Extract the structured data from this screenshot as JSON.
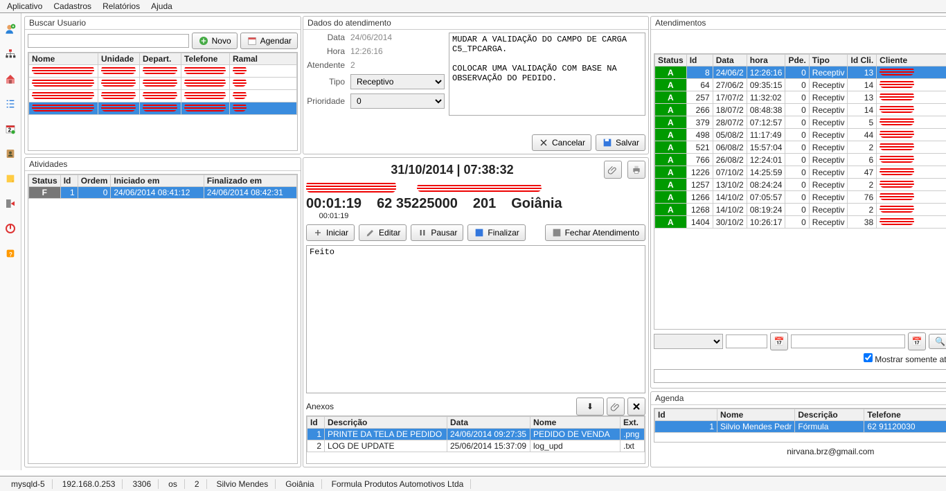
{
  "menu": {
    "app": "Aplicativo",
    "cad": "Cadastros",
    "rel": "Relatórios",
    "ajuda": "Ajuda"
  },
  "search": {
    "title": "Buscar Usuario",
    "novo": "Novo",
    "agendar": "Agendar",
    "cols": {
      "nome": "Nome",
      "unidade": "Unidade",
      "depart": "Depart.",
      "tel": "Telefone",
      "ramal": "Ramal"
    }
  },
  "atividades": {
    "title": "Atividades",
    "cols": {
      "status": "Status",
      "id": "Id",
      "ordem": "Ordem",
      "ini": "Iniciado em",
      "fin": "Finalizado em"
    },
    "row": {
      "status": "F",
      "id": "1",
      "ordem": "0",
      "ini": "24/06/2014 08:41:12",
      "fin": "24/06/2014 08:42:31"
    }
  },
  "dados": {
    "title": "Dados do atendimento",
    "labels": {
      "data": "Data",
      "hora": "Hora",
      "atend": "Atendente",
      "tipo": "Tipo",
      "prio": "Prioridade"
    },
    "data": "24/06/2014",
    "hora": "12:26:16",
    "atendente": "2",
    "tipo": "Receptivo",
    "prio": "0",
    "notes": "MUDAR A VALIDAÇÃO DO CAMPO DE CARGA C5_TPCARGA.\n\nCOLOCAR UMA VALIDAÇÃO COM BASE NA OBSERVAÇÃO DO PEDIDO.",
    "cancelar": "Cancelar",
    "salvar": "Salvar"
  },
  "header": {
    "datetime": "31/10/2014 | 07:38:32",
    "timer": "00:01:19",
    "timer2": "00:01:19",
    "phone": "62 35225000",
    "ext": "201",
    "city": "Goiânia"
  },
  "actions": {
    "iniciar": "Iniciar",
    "editar": "Editar",
    "pausar": "Pausar",
    "finalizar": "Finalizar",
    "fechar": "Fechar Atendimento"
  },
  "editor": {
    "text": "Feito"
  },
  "anexos": {
    "title": "Anexos",
    "cols": {
      "id": "Id",
      "desc": "Descrição",
      "data": "Data",
      "nome": "Nome",
      "ext": "Ext."
    },
    "rows": [
      {
        "id": "1",
        "desc": "PRINTE DA TELA DE PEDIDO",
        "data": "24/06/2014 09:27:35",
        "nome": "PEDIDO DE VENDA",
        "ext": ".png"
      },
      {
        "id": "2",
        "desc": "LOG DE UPDATE",
        "data": "25/06/2014 15:37:09",
        "nome": "log_upd",
        "ext": ".txt"
      }
    ]
  },
  "atend": {
    "title": "Atendimentos",
    "cols": {
      "status": "Status",
      "id": "Id",
      "data": "Data",
      "hora": "hora",
      "pde": "Pde.",
      "tipo": "Tipo",
      "idcli": "Id Cli.",
      "cli": "Cliente"
    },
    "rows": [
      {
        "s": "A",
        "id": "8",
        "data": "24/06/2",
        "hora": "12:26:16",
        "pde": "0",
        "tipo": "Receptiv",
        "idcli": "13"
      },
      {
        "s": "A",
        "id": "64",
        "data": "27/06/2",
        "hora": "09:35:15",
        "pde": "0",
        "tipo": "Receptiv",
        "idcli": "14"
      },
      {
        "s": "A",
        "id": "257",
        "data": "17/07/2",
        "hora": "11:32:02",
        "pde": "0",
        "tipo": "Receptiv",
        "idcli": "13"
      },
      {
        "s": "A",
        "id": "266",
        "data": "18/07/2",
        "hora": "08:48:38",
        "pde": "0",
        "tipo": "Receptiv",
        "idcli": "14"
      },
      {
        "s": "A",
        "id": "379",
        "data": "28/07/2",
        "hora": "07:12:57",
        "pde": "0",
        "tipo": "Receptiv",
        "idcli": "5"
      },
      {
        "s": "A",
        "id": "498",
        "data": "05/08/2",
        "hora": "11:17:49",
        "pde": "0",
        "tipo": "Receptiv",
        "idcli": "44"
      },
      {
        "s": "A",
        "id": "521",
        "data": "06/08/2",
        "hora": "15:57:04",
        "pde": "0",
        "tipo": "Receptiv",
        "idcli": "2"
      },
      {
        "s": "A",
        "id": "766",
        "data": "26/08/2",
        "hora": "12:24:01",
        "pde": "0",
        "tipo": "Receptiv",
        "idcli": "6"
      },
      {
        "s": "A",
        "id": "1226",
        "data": "07/10/2",
        "hora": "14:25:59",
        "pde": "0",
        "tipo": "Receptiv",
        "idcli": "47"
      },
      {
        "s": "A",
        "id": "1257",
        "data": "13/10/2",
        "hora": "08:24:24",
        "pde": "0",
        "tipo": "Receptiv",
        "idcli": "2"
      },
      {
        "s": "A",
        "id": "1266",
        "data": "14/10/2",
        "hora": "07:05:57",
        "pde": "0",
        "tipo": "Receptiv",
        "idcli": "76"
      },
      {
        "s": "A",
        "id": "1268",
        "data": "14/10/2",
        "hora": "08:19:24",
        "pde": "0",
        "tipo": "Receptiv",
        "idcli": "2"
      },
      {
        "s": "A",
        "id": "1404",
        "data": "30/10/2",
        "hora": "10:26:17",
        "pde": "0",
        "tipo": "Receptiv",
        "idcli": "38"
      }
    ],
    "buscar": "Buscar...",
    "checkbox": "Mostrar somente atividades Abertas"
  },
  "agenda": {
    "title": "Agenda",
    "cols": {
      "id": "Id",
      "nome": "Nome",
      "desc": "Descrição",
      "tel": "Telefone"
    },
    "row": {
      "id": "1",
      "nome": "Silvio Mendes Pedr",
      "desc": "Fórmula",
      "tel": "62 91120030"
    },
    "email": "nirvana.brz@gmail.com"
  },
  "status": {
    "db": "mysqld-5",
    "ip": "192.168.0.253",
    "port": "3306",
    "os": "os",
    "n": "2",
    "user": "Silvio Mendes",
    "city": "Goiânia",
    "company": "Formula Produtos Automotivos Ltda"
  }
}
